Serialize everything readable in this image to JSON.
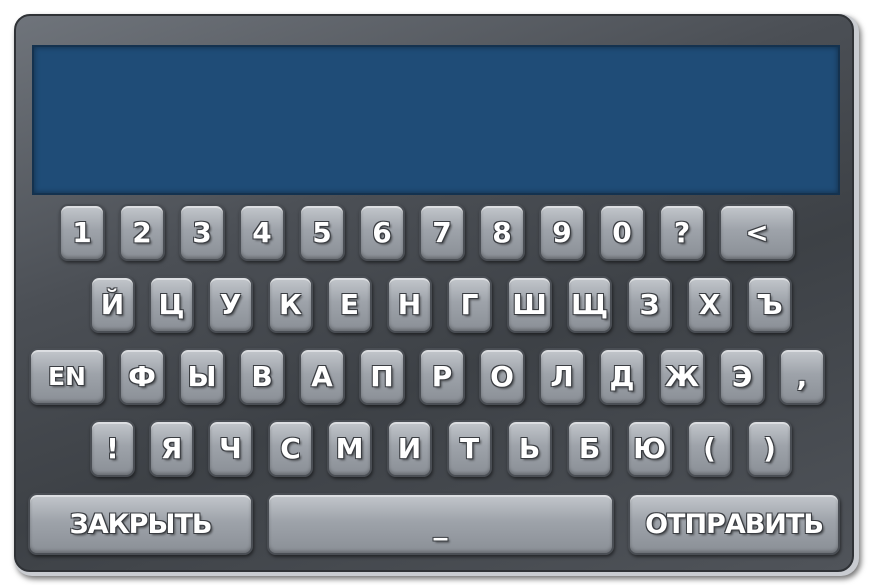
{
  "screen": {
    "text": ""
  },
  "rows": [
    [
      "1",
      "2",
      "3",
      "4",
      "5",
      "6",
      "7",
      "8",
      "9",
      "0",
      "?",
      "<"
    ],
    [
      "Й",
      "Ц",
      "У",
      "К",
      "Е",
      "Н",
      "Г",
      "Ш",
      "Щ",
      "З",
      "Х",
      "Ъ"
    ],
    [
      "EN",
      "Ф",
      "Ы",
      "В",
      "А",
      "П",
      "Р",
      "О",
      "Л",
      "Д",
      "Ж",
      "Э",
      ","
    ],
    [
      "!",
      "Я",
      "Ч",
      "С",
      "М",
      "И",
      "Т",
      "Ь",
      "Б",
      "Ю",
      "(",
      ")"
    ]
  ],
  "bottom": {
    "close_label": "ЗАКРЫТЬ",
    "space_label": "_",
    "send_label": "ОТПРАВИТЬ"
  }
}
